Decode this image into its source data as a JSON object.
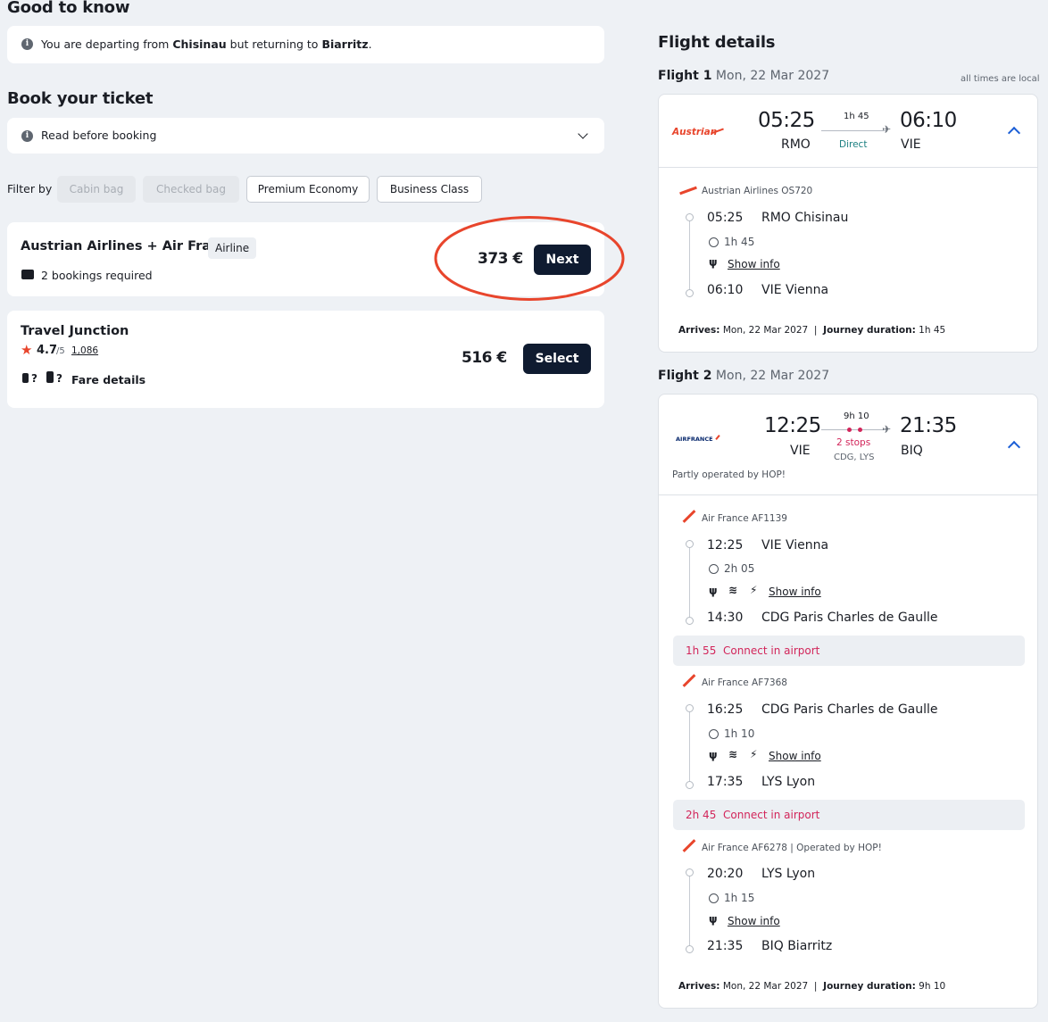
{
  "good_to_know": {
    "title": "Good to know",
    "notice_prefix": "You are departing from ",
    "notice_from": "Chisinau",
    "notice_middle": " but returning to ",
    "notice_to": "Biarritz",
    "notice_suffix": "."
  },
  "book": {
    "title": "Book your ticket",
    "read_before": "Read before booking"
  },
  "filter": {
    "label": "Filter by",
    "chips": [
      "Cabin bag",
      "Checked bag",
      "Premium Economy",
      "Business Class"
    ]
  },
  "offers": [
    {
      "title": "Austrian Airlines + Air France",
      "tag": "Airline",
      "bookings": "2 bookings required",
      "price": "373 €",
      "button": "Next"
    },
    {
      "title": "Travel Junction",
      "rating": "4.7",
      "rating_of": "/5",
      "reviews": "1,086",
      "bag1": "?",
      "bag2": "?",
      "fare_details": "Fare details",
      "price": "516 €",
      "button": "Select"
    }
  ],
  "details": {
    "title": "Flight details",
    "local_note": "all times are local",
    "flight1": {
      "label": "Flight 1",
      "date": "Mon, 22 Mar 2027",
      "logo_text": "Austrian",
      "dep_time": "05:25",
      "dep_code": "RMO",
      "arr_time": "06:10",
      "arr_code": "VIE",
      "duration": "1h 45",
      "stops": "Direct",
      "segments": [
        {
          "airline": "Austrian Airlines OS720",
          "dep_time": "05:25",
          "dep_place": "RMO Chisinau",
          "duration": "1h 45",
          "show_info": "Show info",
          "arr_time": "06:10",
          "arr_place": "VIE Vienna"
        }
      ],
      "arrives_label": "Arrives:",
      "arrives": "Mon, 22 Mar 2027",
      "sep": "|",
      "journey_label": "Journey duration:",
      "journey": "1h 45"
    },
    "flight2": {
      "label": "Flight 2",
      "date": "Mon, 22 Mar 2027",
      "logo_text": "AIRFRANCE",
      "dep_time": "12:25",
      "dep_code": "VIE",
      "arr_time": "21:35",
      "arr_code": "BIQ",
      "duration": "9h 10",
      "stops": "2 stops",
      "via": "CDG, LYS",
      "operated": "Partly operated by HOP!",
      "segments": [
        {
          "airline": "Air France AF1139",
          "dep_time": "12:25",
          "dep_place": "VIE Vienna",
          "duration": "2h 05",
          "show_info": "Show info",
          "arr_time": "14:30",
          "arr_place": "CDG Paris Charles de Gaulle"
        },
        {
          "airline": "Air France AF7368",
          "dep_time": "16:25",
          "dep_place": "CDG Paris Charles de Gaulle",
          "duration": "1h 10",
          "show_info": "Show info",
          "arr_time": "17:35",
          "arr_place": "LYS Lyon"
        },
        {
          "airline": "Air France AF6278 | Operated by HOP!",
          "dep_time": "20:20",
          "dep_place": "LYS Lyon",
          "duration": "1h 15",
          "show_info": "Show info",
          "arr_time": "21:35",
          "arr_place": "BIQ Biarritz"
        }
      ],
      "connections": [
        {
          "time": "1h 55",
          "text": "Connect in airport"
        },
        {
          "time": "2h 45",
          "text": "Connect in airport"
        }
      ],
      "arrives_label": "Arrives:",
      "arrives": "Mon, 22 Mar 2027",
      "sep": "|",
      "journey_label": "Journey duration:",
      "journey": "9h 10"
    }
  },
  "colors": {
    "accent_red": "#e8452c",
    "brand_dark": "#0f1b30",
    "connect_pink": "#d2255a",
    "direct_teal": "#1a7f80",
    "chevron_blue": "#1c5fd6"
  }
}
